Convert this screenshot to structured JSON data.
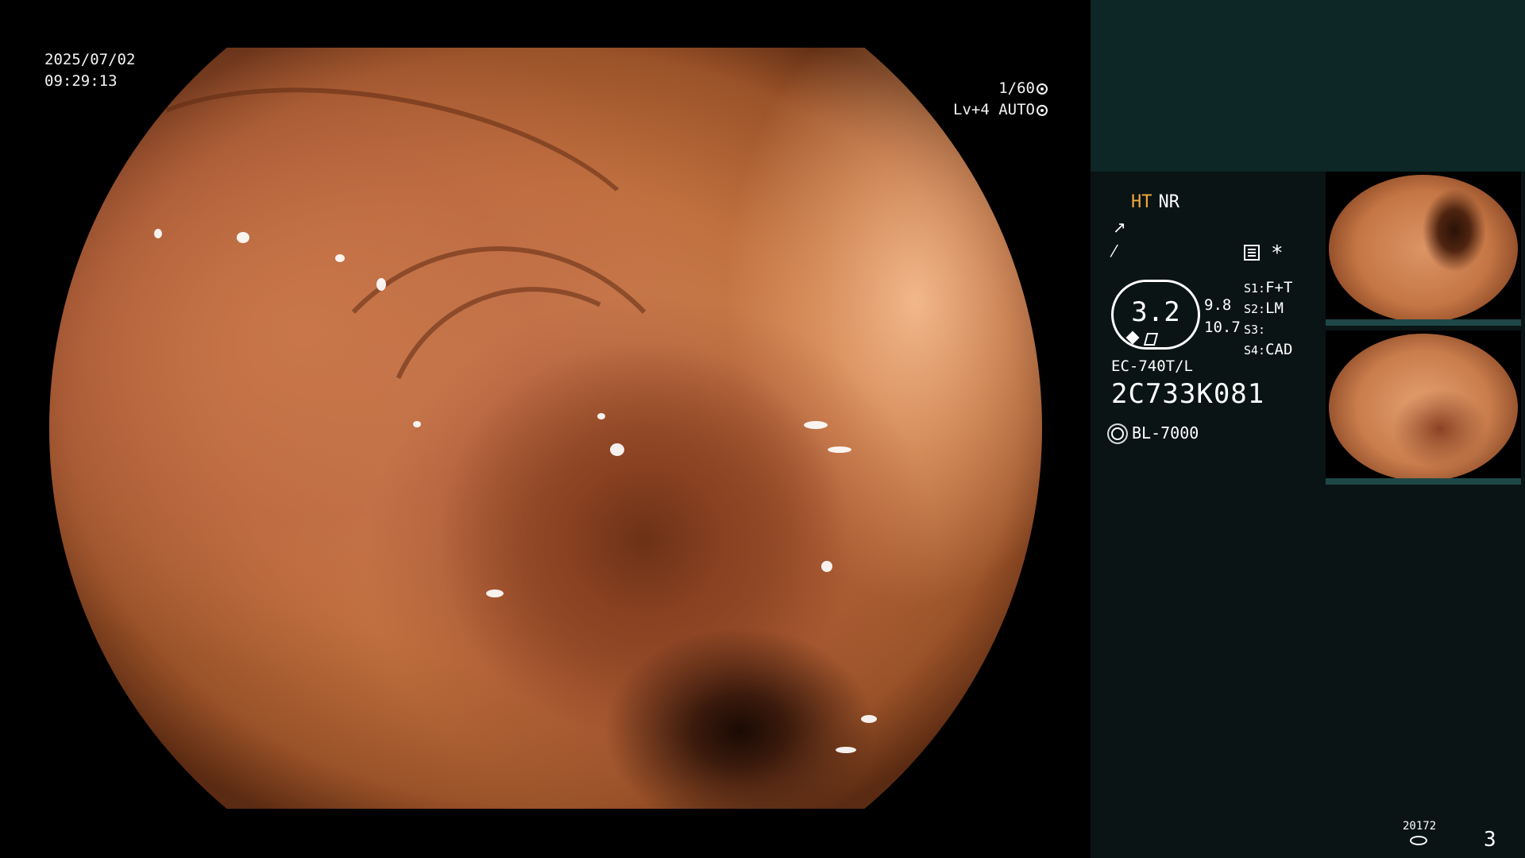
{
  "overlay": {
    "date": "2025/07/02",
    "time": "09:29:13",
    "shutter": "1/60",
    "iris": "Lv+4 AUTO"
  },
  "info_panel": {
    "mode_ht": "HT",
    "mode_nr": "NR",
    "zoom_value": "3.2",
    "zoom_sub_1": "9.8",
    "zoom_sub_2": "10.7",
    "asterisk": "*",
    "s_list": [
      {
        "key": "S1:",
        "value": "F+T"
      },
      {
        "key": "S2:",
        "value": "LM"
      },
      {
        "key": "S3:",
        "value": ""
      },
      {
        "key": "S4:",
        "value": "CAD"
      }
    ],
    "scope_model": "EC-740T/L",
    "scope_serial": "2C733K081",
    "light_source": "BL-7000",
    "record_count": "20172",
    "page_number": "3"
  },
  "colors": {
    "panel_bg": "#0a1414",
    "panel_top_bg": "#0d2626",
    "ht_accent": "#f2a83a"
  },
  "icons": {
    "shutter": "shutter-icon",
    "iris": "iris-icon",
    "structure_enhance": "structure-enhance-icon",
    "color_enhance": "color-enhance-icon",
    "settings": "settings-icon",
    "light": "light-source-icon",
    "record": "record-storage-icon"
  }
}
